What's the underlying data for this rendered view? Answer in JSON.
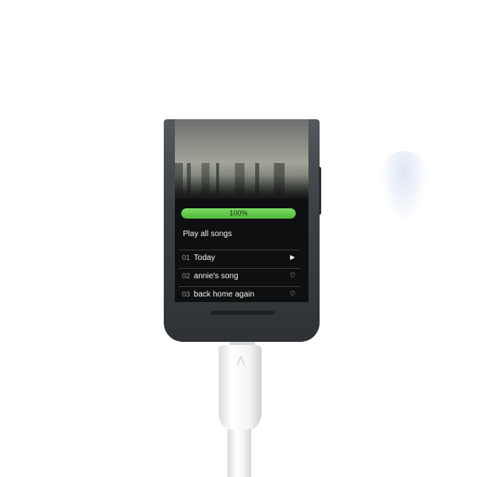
{
  "player": {
    "progress_label": "100%",
    "progress_value": 1.0,
    "play_all": "Play all songs",
    "songs": [
      {
        "number": "01",
        "title": "Today",
        "icon": "play-icon",
        "glyph": "▶"
      },
      {
        "number": "02",
        "title": "annie's song",
        "icon": "heart-icon",
        "glyph": "♡"
      },
      {
        "number": "03",
        "title": "back home again",
        "icon": "heart-icon",
        "glyph": "♡"
      }
    ],
    "colors": {
      "progress_fill": "#5cc845",
      "progress_track": "#2d6b2a",
      "screen_bg": "#0e0f10",
      "phone_body": "#3d4044"
    }
  }
}
